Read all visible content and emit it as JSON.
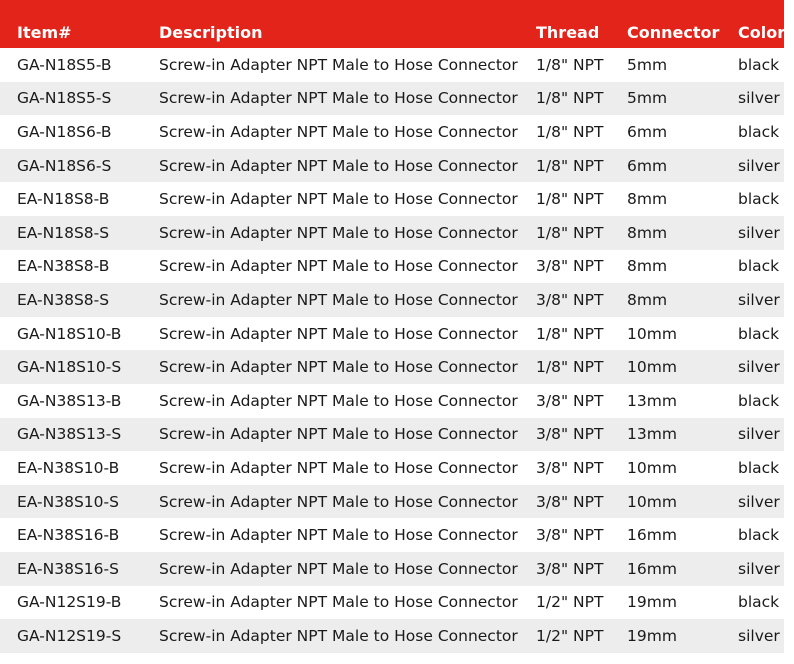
{
  "columns": {
    "item": "Item#",
    "description": "Description",
    "thread": "Thread",
    "connector": "Connector",
    "color": "Color"
  },
  "rows": [
    {
      "item": "GA-N18S5-B",
      "description": "Screw-in Adapter NPT Male to Hose Connector",
      "thread": "1/8\" NPT",
      "connector": "5mm",
      "color": "black"
    },
    {
      "item": "GA-N18S5-S",
      "description": "Screw-in Adapter NPT Male to Hose Connector",
      "thread": "1/8\" NPT",
      "connector": "5mm",
      "color": "silver"
    },
    {
      "item": "GA-N18S6-B",
      "description": "Screw-in Adapter NPT Male to Hose Connector",
      "thread": "1/8\" NPT",
      "connector": "6mm",
      "color": "black"
    },
    {
      "item": "GA-N18S6-S",
      "description": "Screw-in Adapter NPT Male to Hose Connector",
      "thread": "1/8\" NPT",
      "connector": "6mm",
      "color": "silver"
    },
    {
      "item": "EA-N18S8-B",
      "description": "Screw-in Adapter NPT Male to Hose Connector",
      "thread": "1/8\" NPT",
      "connector": "8mm",
      "color": "black"
    },
    {
      "item": "EA-N18S8-S",
      "description": "Screw-in Adapter NPT Male to Hose Connector",
      "thread": "1/8\" NPT",
      "connector": "8mm",
      "color": "silver"
    },
    {
      "item": "EA-N38S8-B",
      "description": "Screw-in Adapter NPT Male to Hose Connector",
      "thread": "3/8\" NPT",
      "connector": "8mm",
      "color": "black"
    },
    {
      "item": "EA-N38S8-S",
      "description": "Screw-in Adapter NPT Male to Hose Connector",
      "thread": "3/8\" NPT",
      "connector": "8mm",
      "color": "silver"
    },
    {
      "item": "GA-N18S10-B",
      "description": "Screw-in Adapter NPT Male to Hose Connector",
      "thread": "1/8\" NPT",
      "connector": "10mm",
      "color": "black"
    },
    {
      "item": "GA-N18S10-S",
      "description": "Screw-in Adapter NPT Male to Hose Connector",
      "thread": "1/8\" NPT",
      "connector": "10mm",
      "color": "silver"
    },
    {
      "item": "GA-N38S13-B",
      "description": "Screw-in Adapter NPT Male to Hose Connector",
      "thread": "3/8\" NPT",
      "connector": "13mm",
      "color": "black"
    },
    {
      "item": "GA-N38S13-S",
      "description": "Screw-in Adapter NPT Male to Hose Connector",
      "thread": "3/8\" NPT",
      "connector": "13mm",
      "color": "silver"
    },
    {
      "item": "EA-N38S10-B",
      "description": "Screw-in Adapter NPT Male to Hose Connector",
      "thread": "3/8\" NPT",
      "connector": "10mm",
      "color": "black"
    },
    {
      "item": "EA-N38S10-S",
      "description": "Screw-in Adapter NPT Male to Hose Connector",
      "thread": "3/8\" NPT",
      "connector": "10mm",
      "color": "silver"
    },
    {
      "item": "EA-N38S16-B",
      "description": "Screw-in Adapter NPT Male to Hose Connector",
      "thread": "3/8\" NPT",
      "connector": "16mm",
      "color": "black"
    },
    {
      "item": "EA-N38S16-S",
      "description": "Screw-in Adapter NPT Male to Hose Connector",
      "thread": "3/8\" NPT",
      "connector": "16mm",
      "color": "silver"
    },
    {
      "item": "GA-N12S19-B",
      "description": "Screw-in Adapter NPT Male to Hose Connector",
      "thread": "1/2\" NPT",
      "connector": "19mm",
      "color": "black"
    },
    {
      "item": "GA-N12S19-S",
      "description": "Screw-in Adapter NPT Male to Hose Connector",
      "thread": "1/2\" NPT",
      "connector": "19mm",
      "color": "silver"
    }
  ],
  "colors": {
    "header_bg": "#e3241b",
    "header_text": "#ffffff",
    "row_alt_bg": "#ededed"
  }
}
